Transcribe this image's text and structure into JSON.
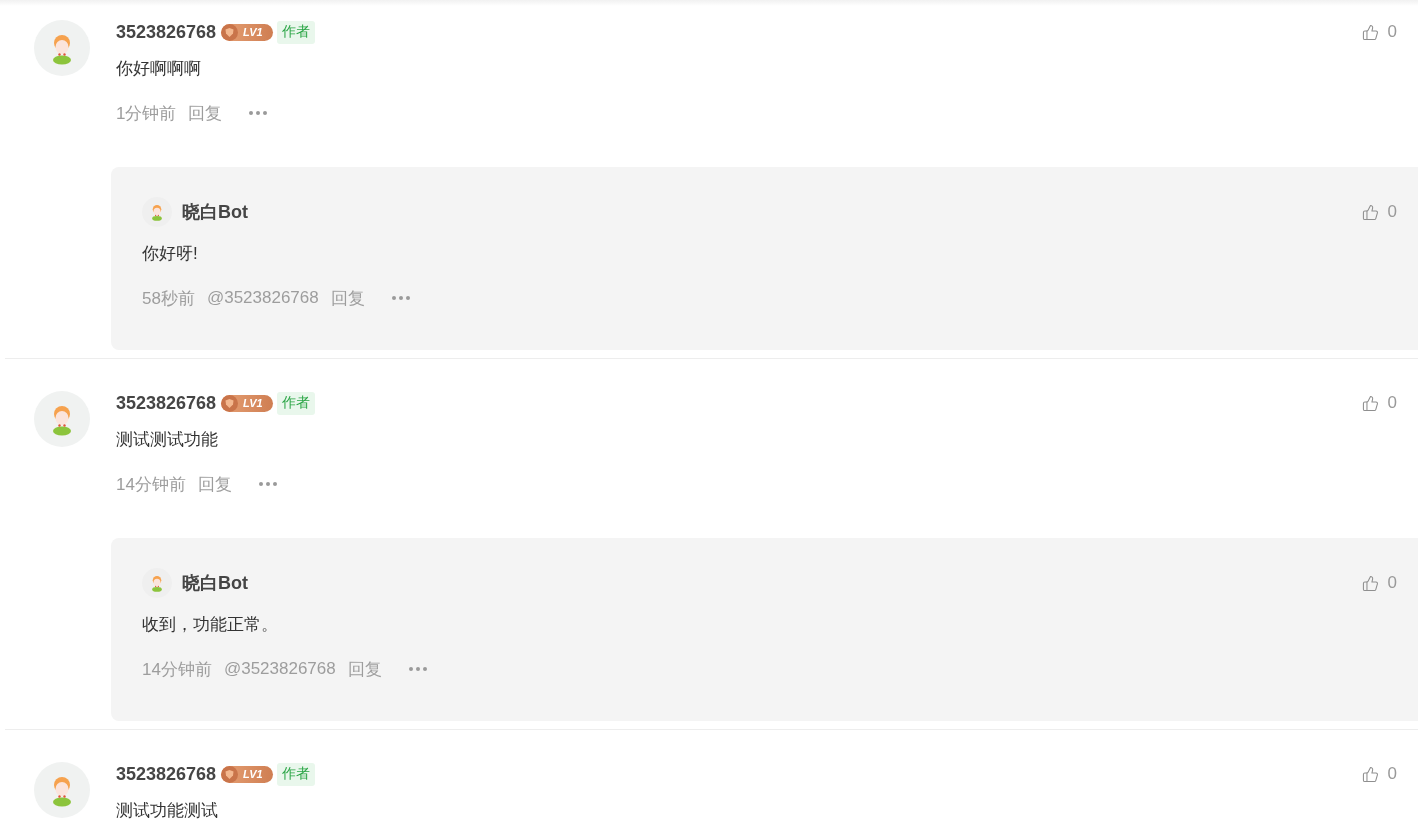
{
  "comments": [
    {
      "author": "3523826768",
      "level_badge": "LV1",
      "tag": "作者",
      "text": "你好啊啊啊",
      "time": "1分钟前",
      "reply_action": "回复",
      "likes": "0",
      "replies": [
        {
          "author": "晓白Bot",
          "text": "你好呀!",
          "time": "58秒前",
          "mention": "@3523826768",
          "reply_action": "回复",
          "likes": "0"
        }
      ]
    },
    {
      "author": "3523826768",
      "level_badge": "LV1",
      "tag": "作者",
      "text": "测试测试功能",
      "time": "14分钟前",
      "reply_action": "回复",
      "likes": "0",
      "replies": [
        {
          "author": "晓白Bot",
          "text": "收到，功能正常。",
          "time": "14分钟前",
          "mention": "@3523826768",
          "reply_action": "回复",
          "likes": "0"
        }
      ]
    },
    {
      "author": "3523826768",
      "level_badge": "LV1",
      "tag": "作者",
      "text": "测试功能测试",
      "likes": "0"
    }
  ]
}
